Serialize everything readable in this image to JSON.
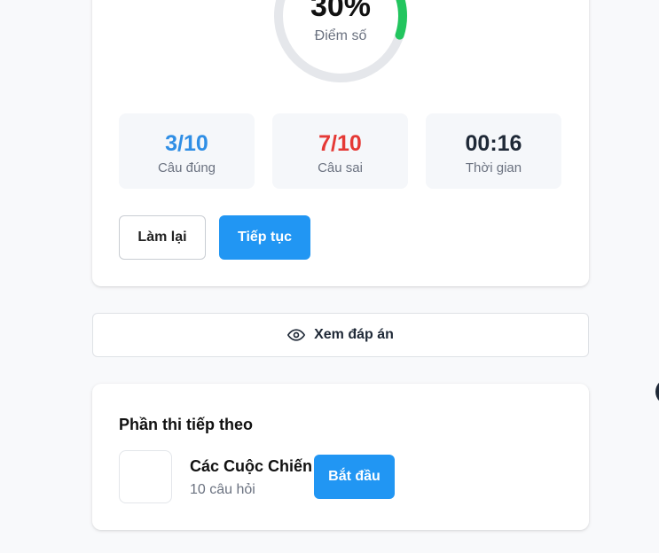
{
  "result": {
    "score": "30%",
    "score_fraction": 0.3,
    "score_label": "Điểm số",
    "colors": {
      "ring_track": "#e5e7eb",
      "ring_fill": "#22c55e"
    },
    "stats": {
      "correct": {
        "value": "3/10",
        "label": "Câu đúng",
        "color": "#2f8ee5"
      },
      "wrong": {
        "value": "7/10",
        "label": "Câu sai",
        "color": "#e53935"
      },
      "time": {
        "value": "00:16",
        "label": "Thời gian",
        "color": "#1f2937"
      }
    },
    "retry_label": "Làm lại",
    "continue_label": "Tiếp tục"
  },
  "answers": {
    "label": "Xem đáp án",
    "icon": "eye-icon"
  },
  "next": {
    "title": "Phần thi tiếp theo",
    "quiz_name": "Các Cuộc Chiến",
    "quiz_count": "10 câu hỏi",
    "start_label": "Bắt đầu"
  }
}
